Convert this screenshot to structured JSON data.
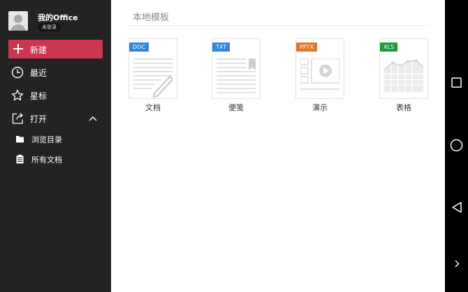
{
  "sidebar": {
    "profile": {
      "name": "我的Office",
      "status": "未登录"
    },
    "new_button": "新建",
    "items": [
      {
        "label": "最近",
        "icon": "clock-icon"
      },
      {
        "label": "星标",
        "icon": "star-icon"
      },
      {
        "label": "打开",
        "icon": "open-icon"
      }
    ],
    "open_subitems": [
      {
        "label": "浏览目录",
        "icon": "folder-icon"
      },
      {
        "label": "所有文档",
        "icon": "documents-icon"
      }
    ]
  },
  "main": {
    "section_title": "本地模板",
    "templates": [
      {
        "tag": "DOC",
        "name": "文档",
        "tag_color": "#2f86e0"
      },
      {
        "tag": "TXT",
        "name": "便笺",
        "tag_color": "#2f86e0"
      },
      {
        "tag": "PPTX",
        "name": "演示",
        "tag_color": "#e0752a"
      },
      {
        "tag": "XLS",
        "name": "表格",
        "tag_color": "#1f9a3b"
      }
    ]
  },
  "colors": {
    "accent": "#cc3650",
    "sidebar_bg": "#232323"
  },
  "system_nav": [
    "square-icon",
    "circle-icon",
    "back-triangle-icon",
    "chevron-right-icon"
  ]
}
